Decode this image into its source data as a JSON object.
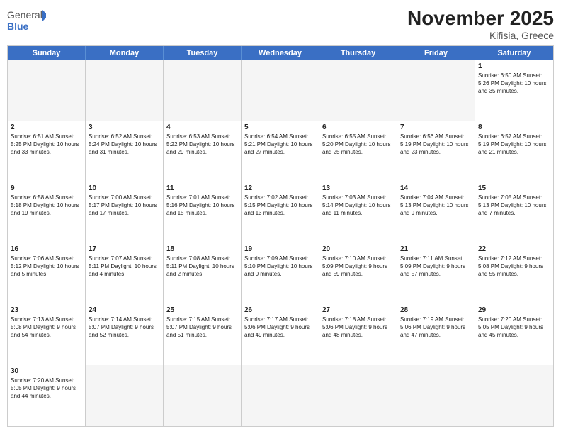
{
  "header": {
    "logo_general": "General",
    "logo_blue": "Blue",
    "title": "November 2025",
    "location": "Kifisia, Greece"
  },
  "days": [
    "Sunday",
    "Monday",
    "Tuesday",
    "Wednesday",
    "Thursday",
    "Friday",
    "Saturday"
  ],
  "weeks": [
    [
      {
        "day": "",
        "info": ""
      },
      {
        "day": "",
        "info": ""
      },
      {
        "day": "",
        "info": ""
      },
      {
        "day": "",
        "info": ""
      },
      {
        "day": "",
        "info": ""
      },
      {
        "day": "",
        "info": ""
      },
      {
        "day": "1",
        "info": "Sunrise: 6:50 AM\nSunset: 5:26 PM\nDaylight: 10 hours\nand 35 minutes."
      }
    ],
    [
      {
        "day": "2",
        "info": "Sunrise: 6:51 AM\nSunset: 5:25 PM\nDaylight: 10 hours\nand 33 minutes."
      },
      {
        "day": "3",
        "info": "Sunrise: 6:52 AM\nSunset: 5:24 PM\nDaylight: 10 hours\nand 31 minutes."
      },
      {
        "day": "4",
        "info": "Sunrise: 6:53 AM\nSunset: 5:22 PM\nDaylight: 10 hours\nand 29 minutes."
      },
      {
        "day": "5",
        "info": "Sunrise: 6:54 AM\nSunset: 5:21 PM\nDaylight: 10 hours\nand 27 minutes."
      },
      {
        "day": "6",
        "info": "Sunrise: 6:55 AM\nSunset: 5:20 PM\nDaylight: 10 hours\nand 25 minutes."
      },
      {
        "day": "7",
        "info": "Sunrise: 6:56 AM\nSunset: 5:19 PM\nDaylight: 10 hours\nand 23 minutes."
      },
      {
        "day": "8",
        "info": "Sunrise: 6:57 AM\nSunset: 5:19 PM\nDaylight: 10 hours\nand 21 minutes."
      }
    ],
    [
      {
        "day": "9",
        "info": "Sunrise: 6:58 AM\nSunset: 5:18 PM\nDaylight: 10 hours\nand 19 minutes."
      },
      {
        "day": "10",
        "info": "Sunrise: 7:00 AM\nSunset: 5:17 PM\nDaylight: 10 hours\nand 17 minutes."
      },
      {
        "day": "11",
        "info": "Sunrise: 7:01 AM\nSunset: 5:16 PM\nDaylight: 10 hours\nand 15 minutes."
      },
      {
        "day": "12",
        "info": "Sunrise: 7:02 AM\nSunset: 5:15 PM\nDaylight: 10 hours\nand 13 minutes."
      },
      {
        "day": "13",
        "info": "Sunrise: 7:03 AM\nSunset: 5:14 PM\nDaylight: 10 hours\nand 11 minutes."
      },
      {
        "day": "14",
        "info": "Sunrise: 7:04 AM\nSunset: 5:13 PM\nDaylight: 10 hours\nand 9 minutes."
      },
      {
        "day": "15",
        "info": "Sunrise: 7:05 AM\nSunset: 5:13 PM\nDaylight: 10 hours\nand 7 minutes."
      }
    ],
    [
      {
        "day": "16",
        "info": "Sunrise: 7:06 AM\nSunset: 5:12 PM\nDaylight: 10 hours\nand 5 minutes."
      },
      {
        "day": "17",
        "info": "Sunrise: 7:07 AM\nSunset: 5:11 PM\nDaylight: 10 hours\nand 4 minutes."
      },
      {
        "day": "18",
        "info": "Sunrise: 7:08 AM\nSunset: 5:11 PM\nDaylight: 10 hours\nand 2 minutes."
      },
      {
        "day": "19",
        "info": "Sunrise: 7:09 AM\nSunset: 5:10 PM\nDaylight: 10 hours\nand 0 minutes."
      },
      {
        "day": "20",
        "info": "Sunrise: 7:10 AM\nSunset: 5:09 PM\nDaylight: 9 hours\nand 59 minutes."
      },
      {
        "day": "21",
        "info": "Sunrise: 7:11 AM\nSunset: 5:09 PM\nDaylight: 9 hours\nand 57 minutes."
      },
      {
        "day": "22",
        "info": "Sunrise: 7:12 AM\nSunset: 5:08 PM\nDaylight: 9 hours\nand 55 minutes."
      }
    ],
    [
      {
        "day": "23",
        "info": "Sunrise: 7:13 AM\nSunset: 5:08 PM\nDaylight: 9 hours\nand 54 minutes."
      },
      {
        "day": "24",
        "info": "Sunrise: 7:14 AM\nSunset: 5:07 PM\nDaylight: 9 hours\nand 52 minutes."
      },
      {
        "day": "25",
        "info": "Sunrise: 7:15 AM\nSunset: 5:07 PM\nDaylight: 9 hours\nand 51 minutes."
      },
      {
        "day": "26",
        "info": "Sunrise: 7:17 AM\nSunset: 5:06 PM\nDaylight: 9 hours\nand 49 minutes."
      },
      {
        "day": "27",
        "info": "Sunrise: 7:18 AM\nSunset: 5:06 PM\nDaylight: 9 hours\nand 48 minutes."
      },
      {
        "day": "28",
        "info": "Sunrise: 7:19 AM\nSunset: 5:06 PM\nDaylight: 9 hours\nand 47 minutes."
      },
      {
        "day": "29",
        "info": "Sunrise: 7:20 AM\nSunset: 5:05 PM\nDaylight: 9 hours\nand 45 minutes."
      }
    ],
    [
      {
        "day": "30",
        "info": "Sunrise: 7:20 AM\nSunset: 5:05 PM\nDaylight: 9 hours\nand 44 minutes."
      },
      {
        "day": "",
        "info": ""
      },
      {
        "day": "",
        "info": ""
      },
      {
        "day": "",
        "info": ""
      },
      {
        "day": "",
        "info": ""
      },
      {
        "day": "",
        "info": ""
      },
      {
        "day": "",
        "info": ""
      }
    ]
  ]
}
